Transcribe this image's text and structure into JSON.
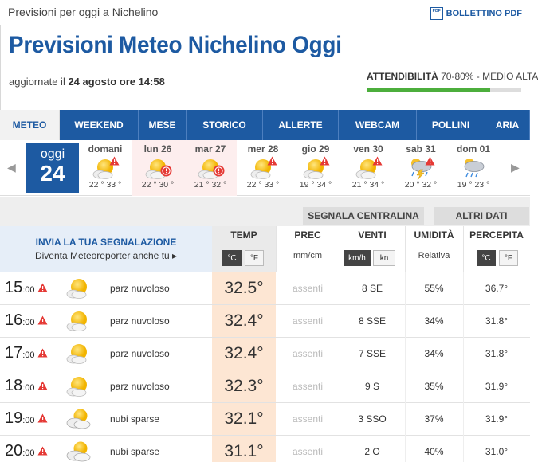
{
  "breadcrumb": "Previsioni per oggi a Nichelino",
  "pdf": {
    "icon_label": "PDF",
    "label": "BOLLETTINO PDF"
  },
  "title": "Previsioni Meteo Nichelino Oggi",
  "updated": {
    "prefix": "aggiornate il ",
    "value": "24 agosto ore 14:58"
  },
  "reliability": {
    "label": "ATTENDIBILITÀ",
    "value": " 70-80% - MEDIO ALTA",
    "fill_percent": 80
  },
  "tabs": [
    {
      "label": "METEO",
      "active": true
    },
    {
      "label": "WEEKEND"
    },
    {
      "label": "MESE"
    },
    {
      "label": "STORICO"
    },
    {
      "label": "ALLERTE"
    },
    {
      "label": "WEBCAM"
    },
    {
      "label": "POLLINI"
    },
    {
      "label": "ARIA"
    }
  ],
  "nav": {
    "prev": "◀",
    "next": "▶"
  },
  "today": {
    "name": "oggi",
    "num": "24"
  },
  "days": [
    {
      "label": "domani",
      "temps": "22 ° 33 °",
      "icon": "sun-cloud-icon",
      "alert": "warning"
    },
    {
      "label": "lun 26",
      "temps": "22 ° 30 °",
      "icon": "sun-cloud-icon",
      "alert": "danger"
    },
    {
      "label": "mar 27",
      "temps": "21 ° 32 °",
      "icon": "sun-cloud-icon",
      "alert": "danger"
    },
    {
      "label": "mer 28",
      "temps": "22 ° 33 °",
      "icon": "sun-cloud-icon",
      "alert": "warning"
    },
    {
      "label": "gio 29",
      "temps": "19 ° 34 °",
      "icon": "sun-cloud-icon",
      "alert": "warning"
    },
    {
      "label": "ven 30",
      "temps": "21 ° 34 °",
      "icon": "sun-cloud-icon",
      "alert": "warning"
    },
    {
      "label": "sab 31",
      "temps": "20 ° 32 °",
      "icon": "thunder-rain-icon",
      "alert": "warning"
    },
    {
      "label": "dom 01",
      "temps": "19 ° 23 °",
      "icon": "rain-cloud-icon",
      "alert": "none"
    }
  ],
  "actions": {
    "report_station": "SEGNALA CENTRALINA",
    "more_data": "ALTRI DATI"
  },
  "report": {
    "title": "INVIA LA TUA SEGNALAZIONE",
    "subtitle": "Diventa Meteoreporter anche tu ▸"
  },
  "columns": {
    "temp": "TEMP",
    "prec": "PREC",
    "wind": "VENTI",
    "hum": "UMIDITÀ",
    "perc": "PERCEPITA",
    "prec_unit": "mm/cm",
    "hum_unit": "Relativa",
    "temp_units": [
      "°C",
      "°F"
    ],
    "wind_units": [
      "km/h",
      "kn"
    ],
    "perc_units": [
      "°C",
      "°F"
    ]
  },
  "hours": [
    {
      "hour": "15",
      "min": ":00",
      "desc": "parz nuvoloso",
      "temp": "32.5°",
      "prec": "assenti",
      "wind": "8  SE",
      "hum": "55%",
      "perc": "36.7°",
      "icon": "sun-cloud-icon"
    },
    {
      "hour": "16",
      "min": ":00",
      "desc": "parz nuvoloso",
      "temp": "32.4°",
      "prec": "assenti",
      "wind": "8  SSE",
      "hum": "34%",
      "perc": "31.8°",
      "icon": "sun-cloud-icon"
    },
    {
      "hour": "17",
      "min": ":00",
      "desc": "parz nuvoloso",
      "temp": "32.4°",
      "prec": "assenti",
      "wind": "7  SSE",
      "hum": "34%",
      "perc": "31.8°",
      "icon": "sun-cloud-icon"
    },
    {
      "hour": "18",
      "min": ":00",
      "desc": "parz nuvoloso",
      "temp": "32.3°",
      "prec": "assenti",
      "wind": "9  S",
      "hum": "35%",
      "perc": "31.9°",
      "icon": "sun-cloud-icon"
    },
    {
      "hour": "19",
      "min": ":00",
      "desc": "nubi sparse",
      "temp": "32.1°",
      "prec": "assenti",
      "wind": "3  SSO",
      "hum": "37%",
      "perc": "31.9°",
      "icon": "cloud-sun-icon"
    },
    {
      "hour": "20",
      "min": ":00",
      "desc": "nubi sparse",
      "temp": "31.1°",
      "prec": "assenti",
      "wind": "2  O",
      "hum": "40%",
      "perc": "31.0°",
      "icon": "cloud-sun-icon"
    }
  ],
  "colors": {
    "brand": "#1d5aa2",
    "warning": "#e53935",
    "temp_cell": "#fde6d3",
    "reliability": "#4cae3c"
  }
}
